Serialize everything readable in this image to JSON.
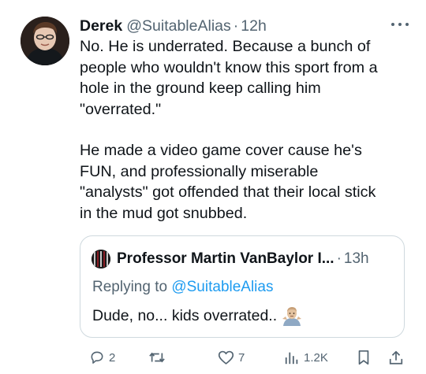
{
  "tweet": {
    "display_name": "Derek",
    "handle": "@SuitableAlias",
    "separator": "·",
    "time": "12h",
    "paragraphs": [
      "No. He is underrated. Because a bunch of\npeople who wouldn't know this sport from a\nhole in the ground keep calling him\n\"overrated.\"",
      "He made a video game cover cause he's\nFUN, and professionally miserable\n\"analysts\" got offended that their local stick\nin the mud got snubbed."
    ]
  },
  "quote": {
    "display_name": "Professor Martin VanBaylor I...",
    "separator": "·",
    "time": "13h",
    "replying_prefix": "Replying to ",
    "replying_handle": "@SuitableAlias",
    "text": "Dude, no... kids overrated..",
    "emoji_icon": "man-shrugging-emoji-icon"
  },
  "actions": {
    "replies": "2",
    "retweets": "",
    "likes": "7",
    "views": "1.2K"
  },
  "colors": {
    "text": "#0f1419",
    "secondary": "#536471",
    "link": "#1d9bf0",
    "border": "#cfd9de"
  }
}
